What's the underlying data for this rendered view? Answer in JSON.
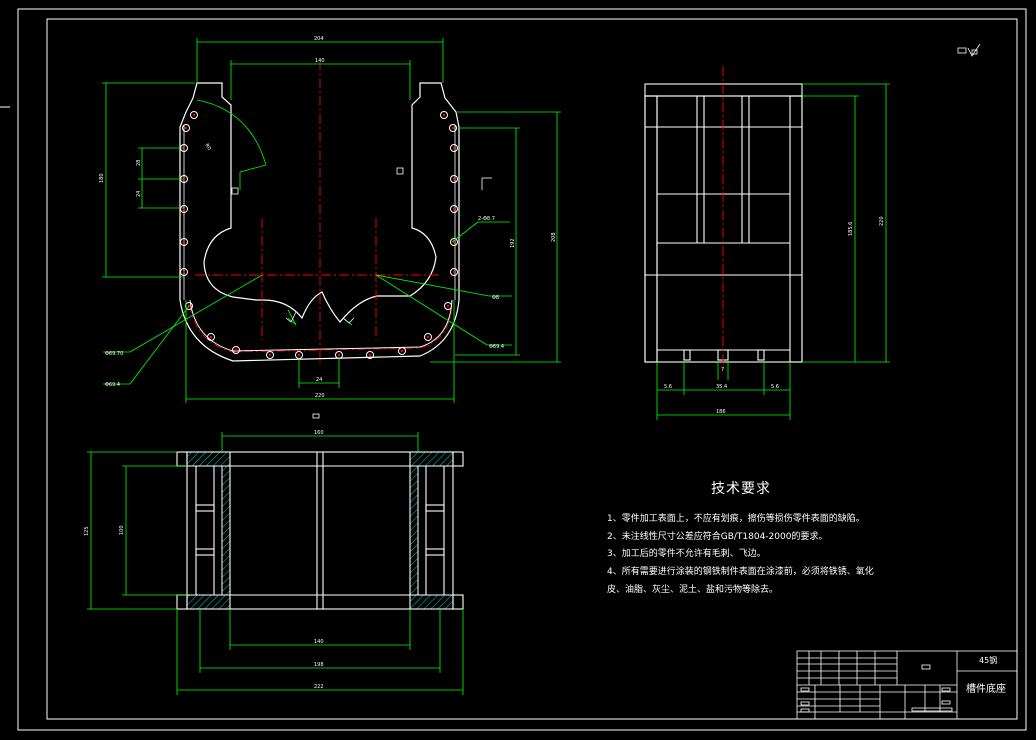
{
  "colors": {
    "background": "#000000",
    "outline": "#ffffff",
    "dimension": "#00ff00",
    "centerline": "#ff0000",
    "hatch": "#00ffff",
    "hole": "#ff0000"
  },
  "front_view": {
    "dims": {
      "top_outer": "204",
      "top_inner": "140",
      "left_height": "180",
      "left_small_1": "28",
      "left_small_2": "24",
      "right_h1": "192",
      "right_h2": "208",
      "bottom_gap": "24",
      "bottom_width": "220",
      "radius_note": "R0",
      "hole_note": "2-Φ8.7",
      "leader_1": "Φ8",
      "leader_2": "Φ69.70",
      "leader_3": "Φ69.4",
      "leader_4": "Φ69.4"
    }
  },
  "side_view": {
    "dims": {
      "height_inner": "185.6",
      "height_outer": "220",
      "width_total": "186",
      "bottom_left": "5.6",
      "bottom_mid": "35.4",
      "bottom_right": "5.6",
      "slot": "7"
    }
  },
  "top_view": {
    "dims": {
      "top": "160",
      "left_outer": "125",
      "left_inner": "100",
      "bottom_1": "140",
      "bottom_2": "198",
      "bottom_3": "222"
    }
  },
  "notes": {
    "title": "技术要求",
    "lines": [
      "1、零件加工表面上，不应有划痕，擦伤等损伤零件表面的缺陷。",
      "2、未注线性尺寸公差应符合GB/T1804-2000的要求。",
      "3、加工后的零件不允许有毛刺、飞边。",
      "4、所有需要进行涂装的钢铁制件表面在涂漆前，必须将铁锈、氧化",
      "皮、油脂、灰尘、泥土、盐和污物等除去。"
    ]
  },
  "title_block": {
    "material": "45钢",
    "part_name": "槽件底座"
  }
}
